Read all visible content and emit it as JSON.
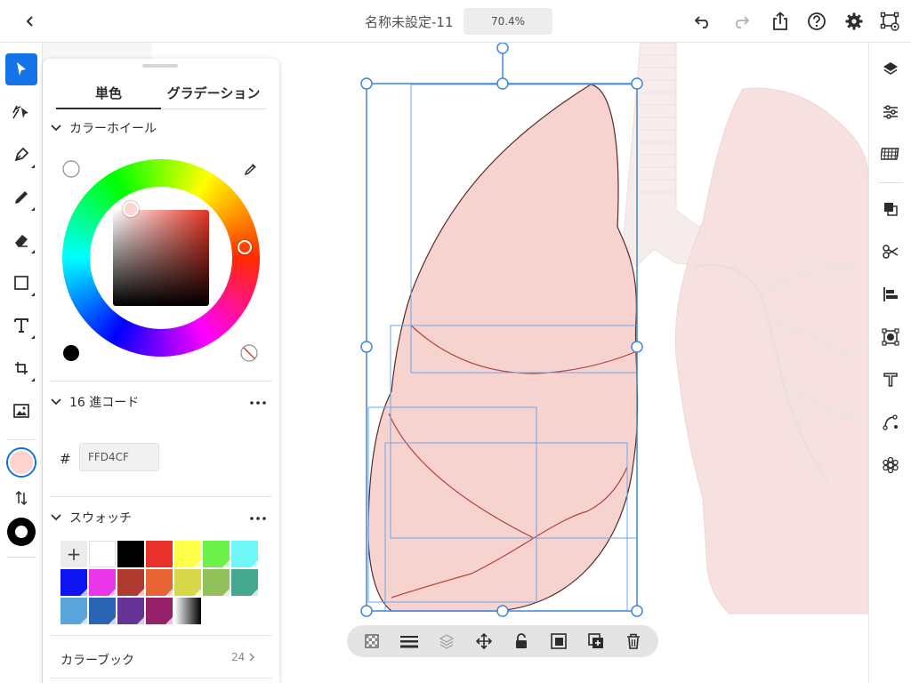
{
  "header": {
    "doc_title": "名称未設定-11",
    "zoom": "70.4%"
  },
  "color_panel": {
    "tabs": [
      {
        "label": "単色",
        "selected": true
      },
      {
        "label": "グラデーション",
        "selected": false
      }
    ],
    "wheel_section": {
      "title": "カラーホイール"
    },
    "hex_section": {
      "title": "16 進コード",
      "hash": "#",
      "value": "FFD4CF"
    },
    "swatch_section": {
      "title": "スウォッチ",
      "add_label": "+",
      "rows": [
        [
          "#ffffff",
          "#000000",
          "#e8312a",
          "#ffff4a",
          "#6cf24a",
          "#6ff6f6"
        ],
        [
          "#0c14f2",
          "#e836e8",
          "#b03a30",
          "#e86434",
          "#d6d84a",
          "#92c05a",
          "#44a88e"
        ],
        [
          "#5aa6dc",
          "#2a64b4",
          "#663496",
          "#96206a",
          "gradient"
        ]
      ]
    },
    "colorbook": {
      "label": "カラーブック",
      "count": "24"
    }
  },
  "fill_color": "#ffd4cf",
  "accent_color": "#1473e6",
  "left_tools": [
    {
      "name": "selection-tool-icon"
    },
    {
      "name": "direct-selection-tool-icon"
    },
    {
      "name": "pen-tool-icon"
    },
    {
      "name": "pencil-tool-icon"
    },
    {
      "name": "eraser-tool-icon"
    },
    {
      "name": "rectangle-tool-icon"
    },
    {
      "name": "type-tool-icon"
    },
    {
      "name": "transform-tool-icon"
    },
    {
      "name": "place-image-icon"
    }
  ],
  "right_tools": [
    {
      "name": "layers-icon"
    },
    {
      "name": "properties-icon"
    },
    {
      "name": "libraries-icon"
    },
    {
      "name": "pathfinder-icon"
    },
    {
      "name": "scissors-icon"
    },
    {
      "name": "align-icon"
    },
    {
      "name": "image-trace-icon"
    },
    {
      "name": "type-settings-icon"
    },
    {
      "name": "path-icon"
    },
    {
      "name": "effects-icon"
    }
  ],
  "object_toolbar": [
    {
      "name": "opacity-icon"
    },
    {
      "name": "stroke-options-icon"
    },
    {
      "name": "arrange-icon"
    },
    {
      "name": "move-icon"
    },
    {
      "name": "lock-icon"
    },
    {
      "name": "clip-icon"
    },
    {
      "name": "duplicate-icon"
    },
    {
      "name": "delete-icon"
    }
  ]
}
